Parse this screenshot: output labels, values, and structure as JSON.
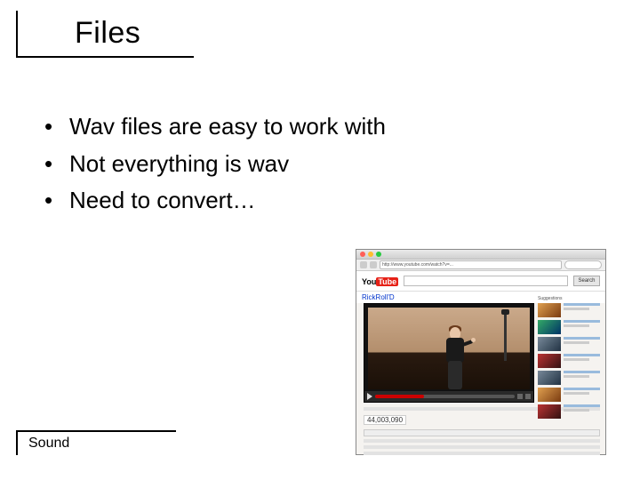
{
  "title": "Files",
  "bullets": [
    "Wav files are easy to work with",
    "Not everything is wav",
    "Need to convert…"
  ],
  "footer": "Sound",
  "screenshot": {
    "url_text": "http://www.youtube.com/watch?v=...",
    "logo_you": "You",
    "logo_tube": "Tube",
    "search_btn": "Search",
    "video_title": "RickRoll'D",
    "views": "44,003,090",
    "suggested_label": "Suggestions"
  }
}
